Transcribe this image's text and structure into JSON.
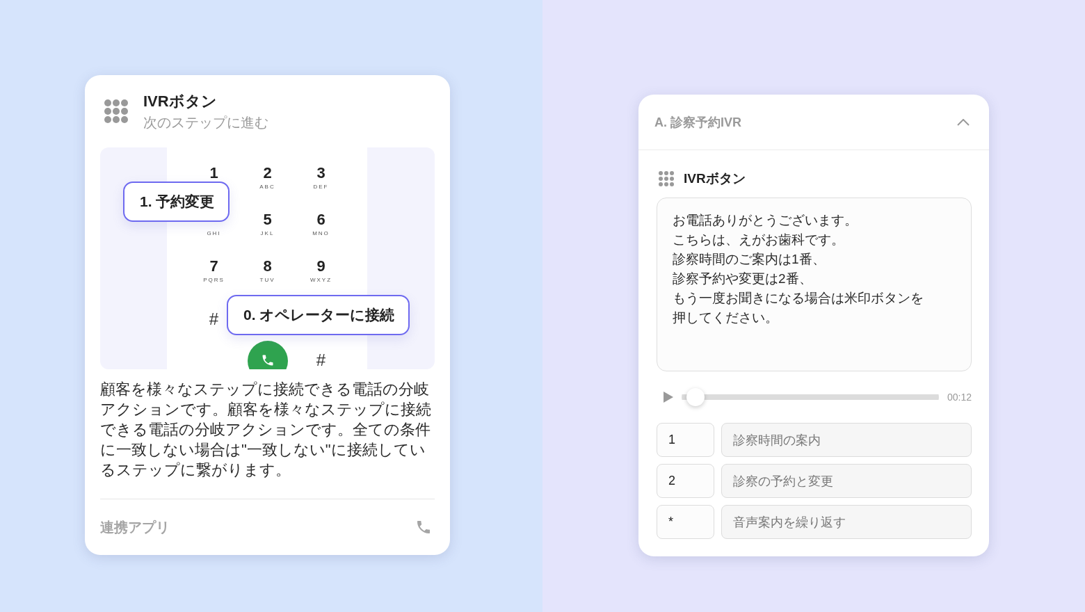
{
  "ivr_card": {
    "title": "IVRボタン",
    "subtitle": "次のステップに進む",
    "keypad": [
      {
        "kind": "digit",
        "digit": "1"
      },
      {
        "kind": "digit",
        "digit": "2",
        "letters": "ABC"
      },
      {
        "kind": "digit",
        "digit": "3",
        "letters": "DEF"
      },
      {
        "kind": "digit",
        "letters": "GHI"
      },
      {
        "kind": "digit",
        "digit": "5",
        "letters": "JKL"
      },
      {
        "kind": "digit",
        "digit": "6",
        "letters": "MNO"
      },
      {
        "kind": "digit",
        "digit": "7",
        "letters": "PQRS"
      },
      {
        "kind": "digit",
        "digit": "8",
        "letters": "TUV"
      },
      {
        "kind": "digit",
        "digit": "9",
        "letters": "WXYZ"
      },
      {
        "kind": "symbol",
        "digit": "#"
      },
      {
        "kind": "blank"
      },
      {
        "kind": "blank"
      },
      {
        "kind": "blank"
      },
      {
        "kind": "call"
      },
      {
        "kind": "symbol",
        "digit": "#"
      }
    ],
    "callouts": [
      {
        "label": "1. 予約変更"
      },
      {
        "label": "0. オペレーターに接続"
      }
    ],
    "description": "顧客を様々なステップに接続できる電話の分岐アクションです。顧客を様々なステップに接続できる電話の分岐アクションです。全ての条件に一致しない場合は\"一致しない\"に接続しているステップに繋がります。",
    "footer": {
      "label": "連携アプリ"
    }
  },
  "flow_panel": {
    "title": "A. 診察予約IVR",
    "expanded": true,
    "step_title": "IVRボタン",
    "message_lines": [
      "お電話ありがとうございます。",
      "こちらは、えがお歯科です。",
      "診察時間のご案内は1番、",
      "診察予約や変更は2番、",
      "もう一度お聞きになる場合は米印ボタンを",
      "押してください。"
    ],
    "player": {
      "level": 0.02,
      "time": "00:12"
    },
    "options": [
      {
        "key": "1",
        "label": "診察時間の案内"
      },
      {
        "key": "2",
        "label": "診察の予約と変更"
      },
      {
        "key": "*",
        "label": "音声案内を繰り返す"
      }
    ]
  }
}
